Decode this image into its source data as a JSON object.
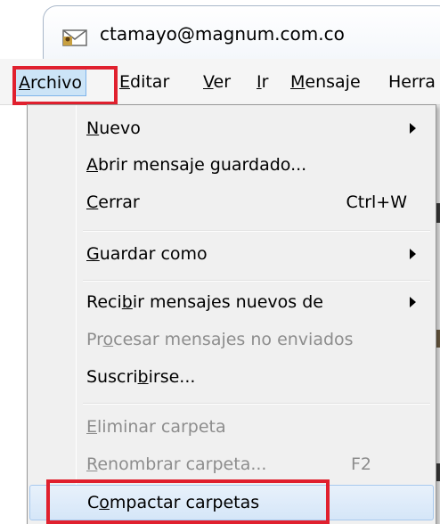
{
  "window": {
    "tab_title": "ctamayo@magnum.com.co",
    "tab_icon": "envelope-icon"
  },
  "menubar": {
    "items": [
      {
        "pre": "",
        "ul": "A",
        "post": "rchivo",
        "name": "archivo"
      },
      {
        "pre": "",
        "ul": "E",
        "post": "ditar",
        "name": "editar"
      },
      {
        "pre": "",
        "ul": "V",
        "post": "er",
        "name": "ver"
      },
      {
        "pre": "",
        "ul": "I",
        "post": "r",
        "name": "ir"
      },
      {
        "pre": "",
        "ul": "M",
        "post": "ensaje",
        "name": "mensaje"
      },
      {
        "pre": "Herra",
        "ul": "",
        "post": "",
        "name": "herramientas"
      }
    ]
  },
  "menu": {
    "items": [
      {
        "pre": "",
        "ul": "N",
        "post": "uevo",
        "shortcut": "",
        "submenu": true,
        "disabled": false
      },
      {
        "pre": "",
        "ul": "A",
        "post": "brir mensaje guardado...",
        "shortcut": "",
        "submenu": false,
        "disabled": false
      },
      {
        "pre": "",
        "ul": "C",
        "post": "errar",
        "shortcut": "Ctrl+W",
        "submenu": false,
        "disabled": false
      },
      {
        "pre": "",
        "ul": "G",
        "post": "uardar como",
        "shortcut": "",
        "submenu": true,
        "disabled": false
      },
      {
        "pre": "Reci",
        "ul": "b",
        "post": "ir mensajes nuevos de",
        "shortcut": "",
        "submenu": true,
        "disabled": false
      },
      {
        "pre": "Pr",
        "ul": "o",
        "post": "cesar mensajes no enviados",
        "shortcut": "",
        "submenu": false,
        "disabled": true
      },
      {
        "pre": "Suscri",
        "ul": "b",
        "post": "irse...",
        "shortcut": "",
        "submenu": false,
        "disabled": false
      },
      {
        "pre": "",
        "ul": "E",
        "post": "liminar carpeta",
        "shortcut": "",
        "submenu": false,
        "disabled": true
      },
      {
        "pre": "",
        "ul": "R",
        "post": "enombrar carpeta...",
        "shortcut": "F2",
        "submenu": false,
        "disabled": true
      },
      {
        "pre": "C",
        "ul": "o",
        "post": "mpactar carpetas",
        "shortcut": "",
        "submenu": false,
        "disabled": false
      }
    ]
  },
  "colors": {
    "highlight_box": "#e0202e",
    "menu_hover": "#d5e6f8",
    "disabled_text": "#8d8d8d"
  }
}
